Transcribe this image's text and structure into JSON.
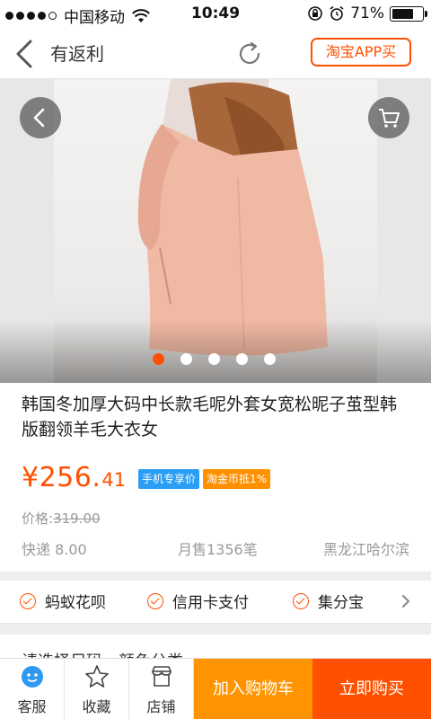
{
  "status_bar": {
    "carrier": "中国移动",
    "time": "10:49",
    "battery": "71%",
    "battery_level": 0.71,
    "signal_bars_filled": 4,
    "signal_bars_total": 5
  },
  "nav": {
    "title": "有返利",
    "taobao_app_label": "淘宝APP买"
  },
  "carousel": {
    "image_count": 5,
    "active_index": 0
  },
  "product": {
    "title": "韩国冬加厚大码中长款毛呢外套女宽松昵子茧型韩版翻领羊毛大衣女",
    "price_main": "¥256.",
    "price_decimal": "41",
    "badge_mobile": "手机专享价",
    "badge_coin": "淘金币抵1%",
    "original_price_label": "价格:",
    "original_price": "319.00",
    "shipping": "快递 8.00",
    "monthly_sales": "月售1356笔",
    "location": "黑龙江哈尔滨"
  },
  "payment_methods": [
    "蚂蚁花呗",
    "信用卡支付",
    "集分宝"
  ],
  "select_prompt": "请选择尺码，颜色分类",
  "bottom_bar": {
    "service_label": "客服",
    "favorite_label": "收藏",
    "shop_label": "店铺",
    "add_to_cart_label": "加入购物车",
    "buy_now_label": "立即购买"
  },
  "colors": {
    "accent": "#ff5000",
    "cart_button": "#ff9400",
    "badge_blue": "#2a9df4",
    "badge_orange": "#ff9000"
  }
}
